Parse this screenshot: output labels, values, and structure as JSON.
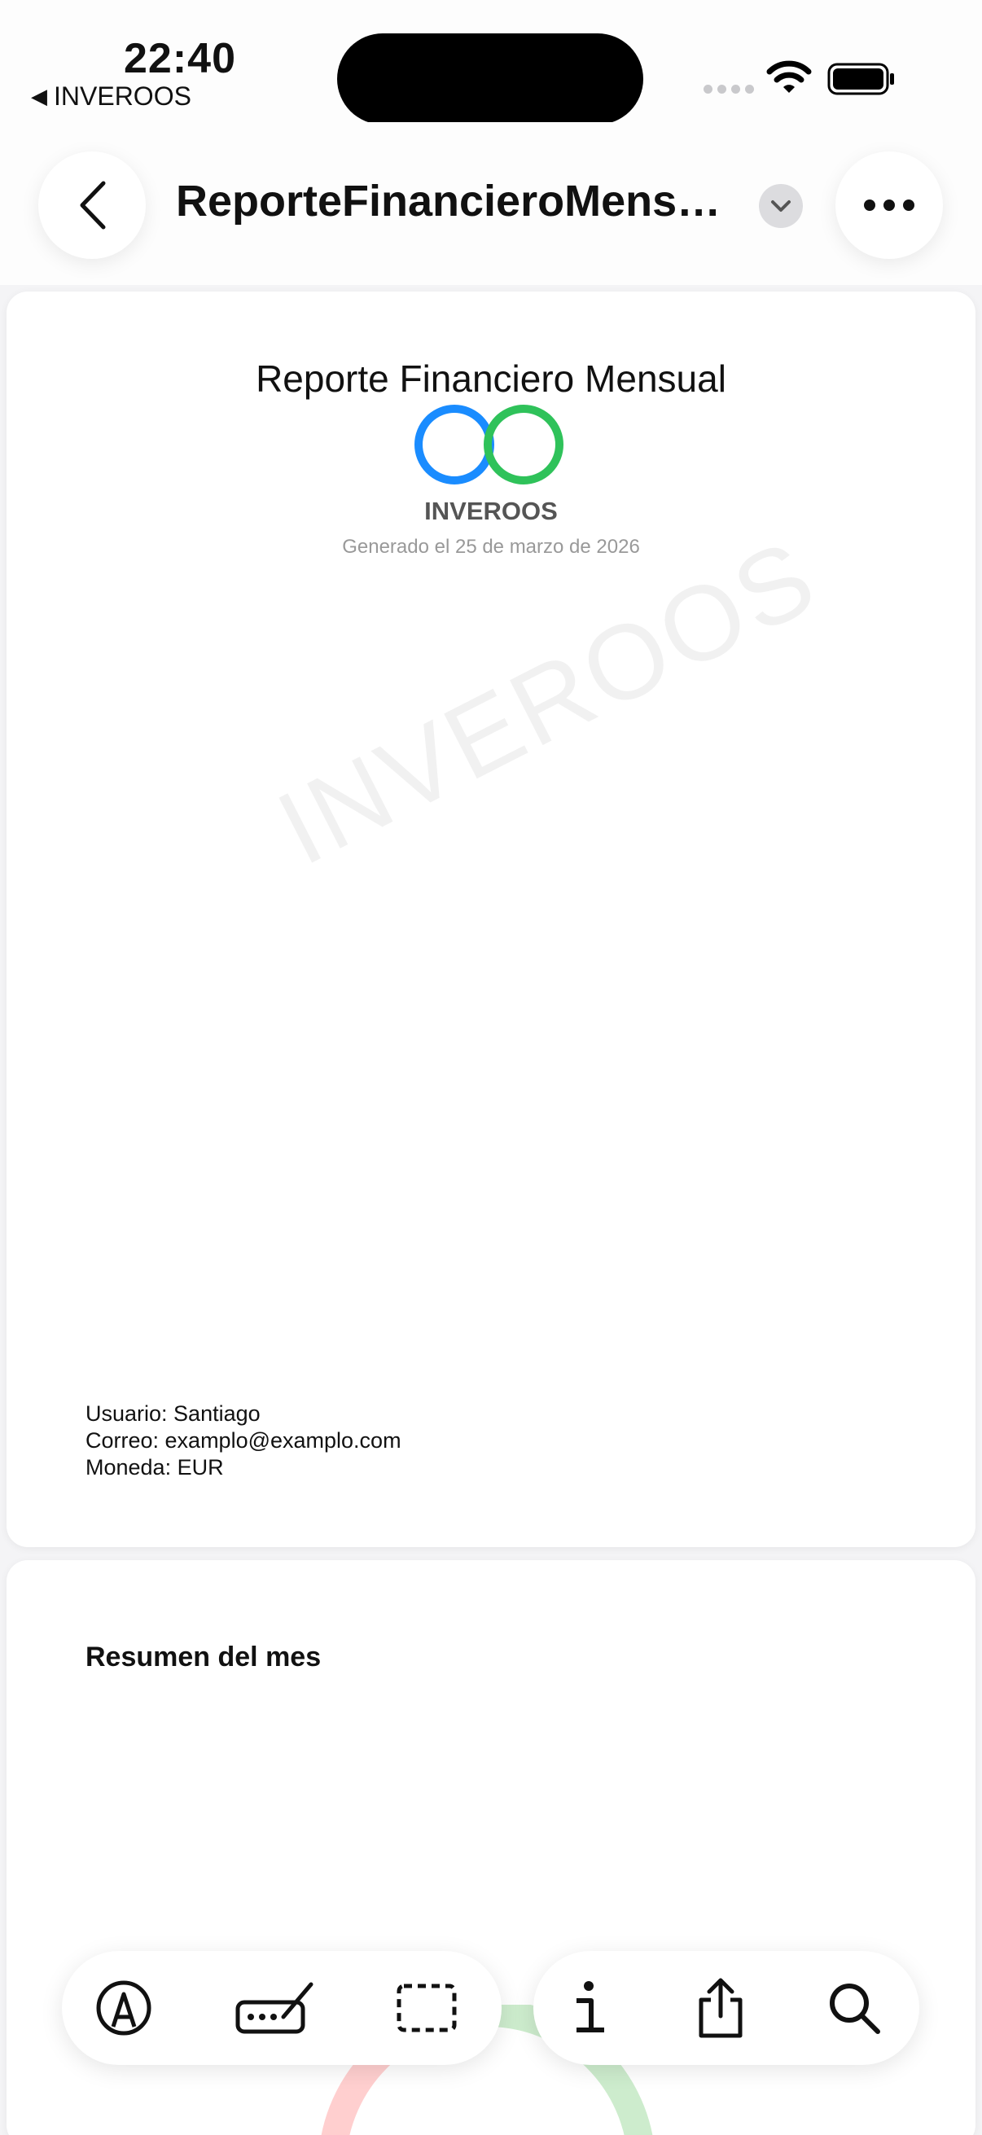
{
  "status_bar": {
    "time": "22:40",
    "back_app_label": "INVEROOS",
    "icons": [
      "cellular-dots-icon",
      "wifi-icon",
      "battery-icon"
    ]
  },
  "nav": {
    "title": "ReporteFinancieroMensual...",
    "back_icon": "chevron-left-icon",
    "title_menu_icon": "chevron-down-icon",
    "more_icon": "ellipsis-icon"
  },
  "page1": {
    "title": "Reporte Financiero Mensual",
    "brand": "INVEROOS",
    "generated": "Generado el 25 de marzo de 2026",
    "watermark": "INVEROOS",
    "user_info": {
      "user": "Usuario: Santiago",
      "email": "Correo: examplo@examplo.com",
      "currency": "Moneda: EUR"
    },
    "colors": {
      "logo_blue": "#1a8cff",
      "logo_green": "#2fc25a"
    }
  },
  "page2": {
    "section_title": "Resumen del mes"
  },
  "toolbar": {
    "left": [
      "markup-pen-icon",
      "signature-icon",
      "selection-rect-icon"
    ],
    "right": [
      "info-icon",
      "share-icon",
      "search-icon"
    ]
  }
}
